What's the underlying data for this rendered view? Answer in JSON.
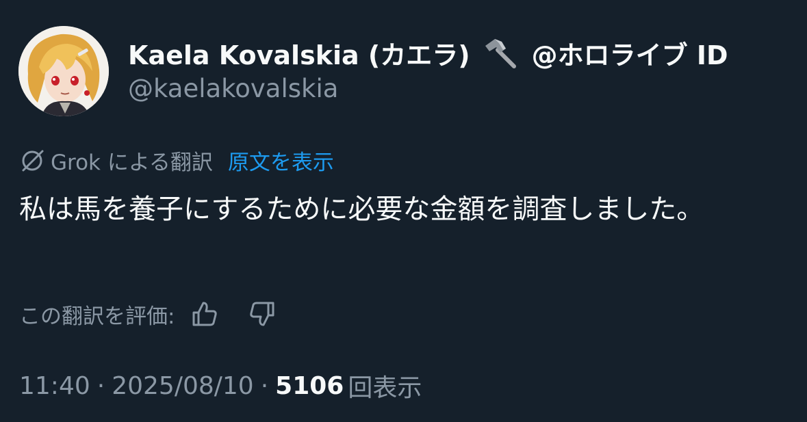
{
  "author": {
    "display_name": "Kaela Kovalskia (カエラ)",
    "affiliation": "@ホロライブ ID",
    "handle": "@kaelakovalskia",
    "emoji_icon": "hammer-icon"
  },
  "translation": {
    "label": "Grok による翻訳",
    "show_original": "原文を表示",
    "icon": "grok-icon"
  },
  "tweet": {
    "text": "私は馬を養子にするために必要な金額を調査しました。"
  },
  "rating": {
    "prompt": "この翻訳を評価:",
    "thumbs_up_icon": "thumbs-up-icon",
    "thumbs_down_icon": "thumbs-down-icon"
  },
  "meta": {
    "time": "11:40",
    "separator": "·",
    "date": "2025/08/10",
    "views_count": "5106",
    "views_label": "回表示"
  },
  "colors": {
    "background": "#15202b",
    "primary_text": "#f7f9f9",
    "secondary_text": "#8b98a5",
    "link": "#1d9bf0"
  }
}
